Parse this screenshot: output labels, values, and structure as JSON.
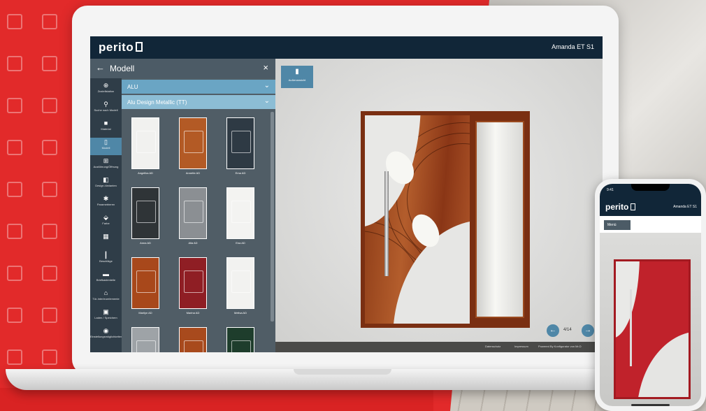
{
  "app": {
    "logo": "perito",
    "door_name": "Amanda ET S1"
  },
  "panel": {
    "title": "Modell",
    "material": "ALU",
    "collection": "Alu Design Metallic (TT)"
  },
  "sidebar": {
    "items": [
      {
        "icon": "globe-icon",
        "glyph": "⊕",
        "label": "Zustellstation"
      },
      {
        "icon": "search-icon",
        "glyph": "⚲",
        "label": "Suche nach Modell"
      },
      {
        "icon": "material-icon",
        "glyph": "■",
        "label": "Material"
      },
      {
        "icon": "door-icon",
        "glyph": "▯",
        "label": "Modell"
      },
      {
        "icon": "layout-icon",
        "glyph": "⊞",
        "label": "Ausführung/Öffnung"
      },
      {
        "icon": "variant-icon",
        "glyph": "◧",
        "label": "Design-Varianten"
      },
      {
        "icon": "dimensions-icon",
        "glyph": "✱",
        "label": "Parametrieren"
      },
      {
        "icon": "paint-icon",
        "glyph": "⬙",
        "label": "Farbe"
      },
      {
        "icon": "glass-icon",
        "glyph": "▦",
        "label": ""
      },
      {
        "icon": "handle-icon",
        "glyph": "┃",
        "label": "Beschläge"
      },
      {
        "icon": "mail-icon",
        "glyph": "▬",
        "label": "Briefkastenteile"
      },
      {
        "icon": "home-icon",
        "glyph": "⌂",
        "label": "Tür-Interieurelemente"
      },
      {
        "icon": "image-icon",
        "glyph": "▣",
        "label": "Laden / Speichern"
      },
      {
        "icon": "camera-icon",
        "glyph": "◉",
        "label": "Einstellungsmöglichkeiten"
      }
    ]
  },
  "models": [
    {
      "name": "Angelika AD",
      "color": "#f1f1ef"
    },
    {
      "name": "Annette AD",
      "color": "#b35a25"
    },
    {
      "name": "Ema AD",
      "color": "#2e3a44"
    },
    {
      "name": "Anna AD",
      "color": "#2f3437"
    },
    {
      "name": "Alia AD",
      "color": "#8b8f93"
    },
    {
      "name": "Ena AD",
      "color": "#f3f3f1"
    },
    {
      "name": "Marilyn AD",
      "color": "#a8481b"
    },
    {
      "name": "Marina AD",
      "color": "#8f1e24"
    },
    {
      "name": "Melisa AD",
      "color": "#f2f2f0"
    },
    {
      "name": "",
      "color": "#9ea3a7"
    },
    {
      "name": "",
      "color": "#a84a1d"
    },
    {
      "name": "",
      "color": "#1e3d2c"
    }
  ],
  "viewer": {
    "view_button_label": "Außenansicht",
    "position": "4/14",
    "prev_label": "←",
    "next_label": "→",
    "footer_links": [
      "Datenschutz",
      "Impressum",
      "Powered By Konfigurator von Mr.D"
    ]
  },
  "phone": {
    "time": "9:41",
    "logo": "perito",
    "door_name": "Amanda ET S1",
    "menu_label": "Menü"
  }
}
